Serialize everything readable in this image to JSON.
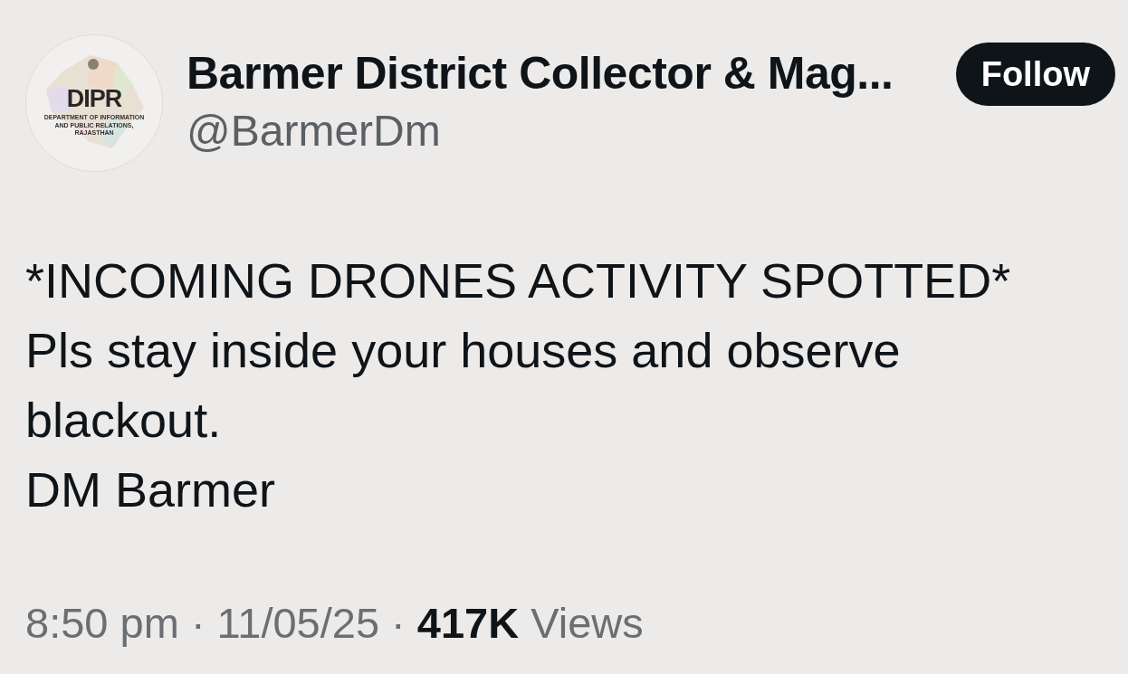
{
  "author": {
    "avatar": {
      "kind": "picture",
      "logo_text": "DIPR",
      "logo_subtitle": "DEPARTMENT OF INFORMATION AND PUBLIC RELATIONS, RAJASTHAN"
    },
    "name": "Barmer District Collector & Mag...",
    "handle": "@BarmerDm"
  },
  "follow_button": {
    "label": "Follow"
  },
  "post": {
    "lines": [
      "*INCOMING DRONES ACTIVITY SPOTTED*",
      "Pls stay inside your houses and observe blackout.",
      "DM Barmer"
    ]
  },
  "meta": "8:50 pm · 11/05/25 · **417K** Views"
}
